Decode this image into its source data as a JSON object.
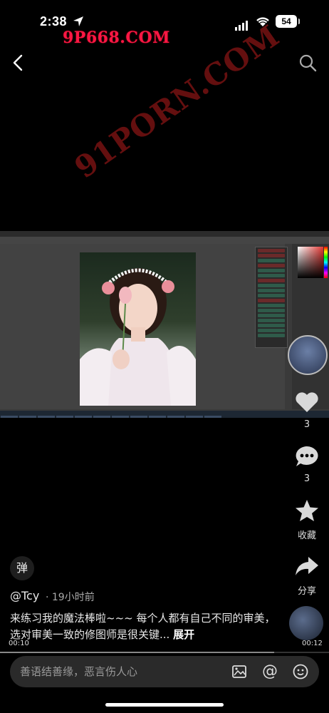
{
  "status_bar": {
    "time": "2:38",
    "battery": "54"
  },
  "watermark": {
    "top": "9P668.COM",
    "diagonal": "91PORN.COM"
  },
  "video": {
    "progress": 0.833,
    "elapsed": "00:10",
    "duration": "00:12"
  },
  "actions": {
    "like_count": "3",
    "comment_count": "3",
    "favorite_label": "收藏",
    "share_label": "分享"
  },
  "post": {
    "danmu_label": "弹",
    "author": "@Tcy",
    "time_ago": "· 19小时前",
    "caption": "来练习我的魔法棒啦~~~ 每个人都有自己不同的审美，选对审美一致的修图师是很关键...",
    "expand_label": "展开"
  },
  "comment_bar": {
    "placeholder": "善语结善缘，恶言伤人心"
  },
  "colors": {
    "background": "#000000",
    "watermark": "#ff1744"
  }
}
